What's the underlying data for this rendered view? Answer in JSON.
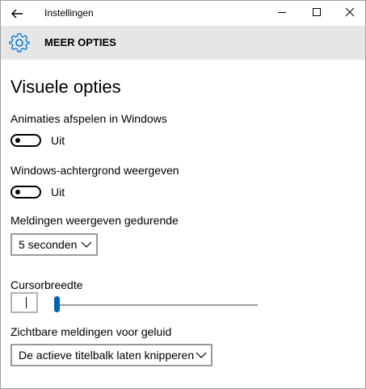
{
  "window": {
    "title": "Instellingen",
    "back_icon": "arrow-left-icon",
    "controls": [
      "minimize-icon",
      "maximize-icon",
      "close-icon"
    ]
  },
  "header": {
    "icon": "gear-icon",
    "title": "MEER OPTIES",
    "accent": "#0078d7"
  },
  "main": {
    "section_title": "Visuele opties",
    "animations": {
      "label": "Animaties afspelen in Windows",
      "state_text": "Uit",
      "on": false
    },
    "background": {
      "label": "Windows-achtergrond weergeven",
      "state_text": "Uit",
      "on": false
    },
    "notifications": {
      "label": "Meldingen weergeven gedurende",
      "selected": "5 seconden"
    },
    "cursor": {
      "label": "Cursorbreedte",
      "level": 0
    },
    "visual_alerts": {
      "label": "Zichtbare meldingen voor geluid",
      "selected": "De actieve titelbalk laten knipperen"
    }
  },
  "colors": {
    "header_bg": "#e6e6e6",
    "slider_thumb": "#0063b1"
  }
}
